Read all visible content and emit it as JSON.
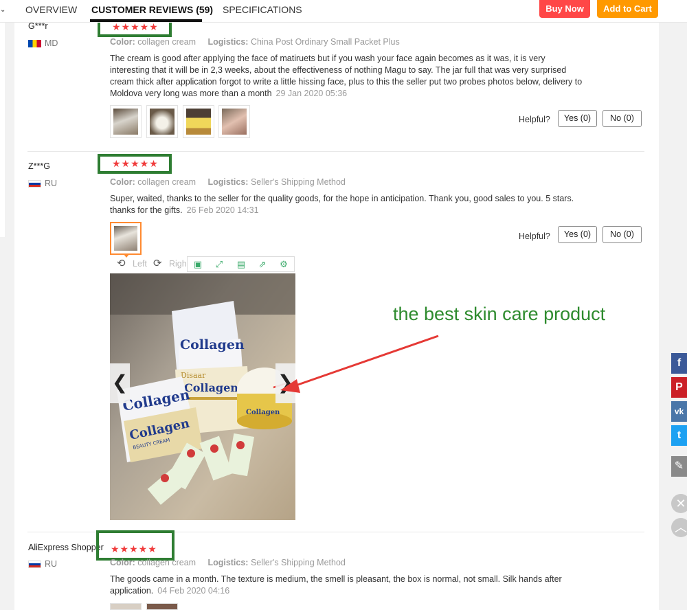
{
  "tabs": {
    "caret": "⌄",
    "overview": "OVERVIEW",
    "reviews": "CUSTOMER REVIEWS (59)",
    "specifications": "SPECIFICATIONS"
  },
  "actions": {
    "buy_now": "Buy Now",
    "add_to_cart": "Add to Cart"
  },
  "labels": {
    "color": "Color:",
    "logistics": "Logistics:",
    "helpful": "Helpful?",
    "yes": "Yes (0)",
    "no": "No (0)",
    "rotate_left": "Left",
    "rotate_right": "Righ",
    "stars": "★★★★★"
  },
  "reviews": [
    {
      "user": "G***r",
      "country": "MD",
      "color": "collagen cream",
      "logistics": "China Post Ordinary Small Packet Plus",
      "text": "The cream is good after applying the face of matiruets but if you wash your face again becomes as it was, it is very interesting that it will be in 2,3 weeks, about the effectiveness of nothing Magu to say. The jar full that was very surprised cream thick after application forgot to write a little hissing face, plus to this the seller put two probes photos below, delivery to Moldova very long was more than a month",
      "date": "29 Jan 2020 05:36"
    },
    {
      "user": "Z***G",
      "country": "RU",
      "color": "collagen cream",
      "logistics": "Seller's Shipping Method",
      "text": "Super, waited, thanks to the seller for the quality goods, for the hope in anticipation. Thank you, good sales to you. 5 stars. thanks for the gifts.",
      "date": "26 Feb 2020 14:31"
    },
    {
      "user": "AliExpress Shopper",
      "country": "RU",
      "color": "collagen cream",
      "logistics": "Seller's Shipping Method",
      "text": "The goods came in a month. The texture is medium, the smell is pleasant, the box is normal, not small. Silk hands after application.",
      "date": "04 Feb 2020 04:16"
    }
  ],
  "photo": {
    "box_brand": "Collagen",
    "box_subtitle": "Disaar",
    "box_line": "BEAUTY CREAM",
    "prev": "❮",
    "next": "❯"
  },
  "annotation": "the best skin care product",
  "social_icons": [
    "facebook-icon",
    "pinterest-icon",
    "vk-icon",
    "twitter-icon",
    "edit-icon",
    "close-icon",
    "up-icon"
  ],
  "social_glyphs": {
    "facebook": "f",
    "pinterest": "P",
    "vk": "vk",
    "twitter": "t",
    "edit": "✎",
    "close": "✕",
    "up": "︿"
  },
  "colors": {
    "buy_now": "#ff4747",
    "add_to_cart": "#ff9900",
    "stars": "#f03b3b",
    "highlight_box": "#2e7d32",
    "annotation": "#2e8b2e",
    "tool_icons": "#3aaa6a"
  }
}
